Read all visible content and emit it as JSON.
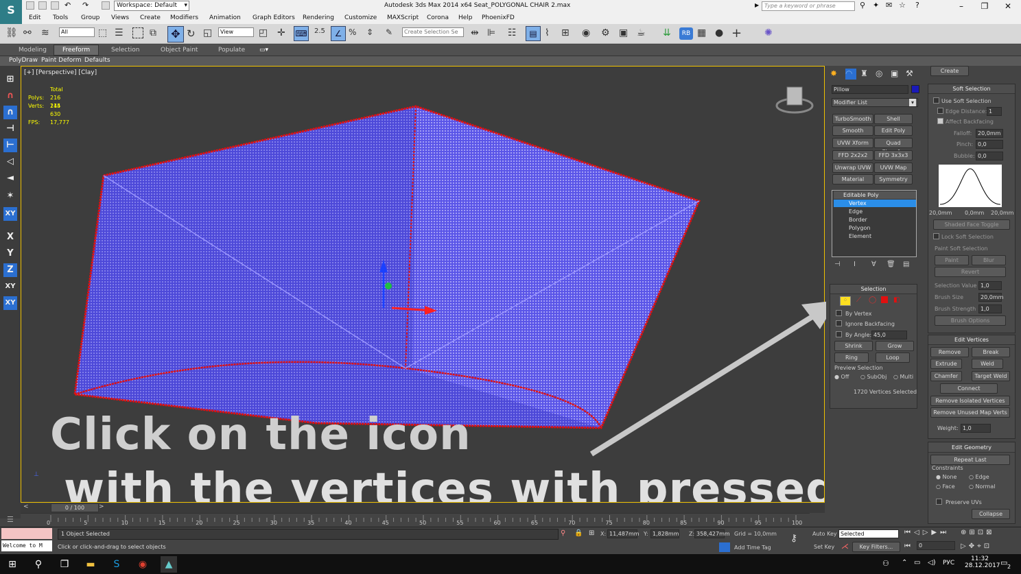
{
  "app": {
    "logo": "S",
    "workspace_label": "Workspace: Default",
    "title": "Autodesk 3ds Max  2014 x64     Seat_POLYGONAL CHAIR 2.max",
    "search_placeholder": "Type a keyword or phrase"
  },
  "menu": [
    "Edit",
    "Tools",
    "Group",
    "Views",
    "Create",
    "Modifiers",
    "Animation",
    "Graph Editors",
    "Rendering",
    "Customize",
    "MAXScript",
    "Corona",
    "Help",
    "PhoenixFD"
  ],
  "toolbar": {
    "selection_filter": "All",
    "ref_coord": "View",
    "snap_value": "2.5",
    "named_selection_placeholder": "Create Selection Se"
  },
  "ribbon": {
    "tabs": [
      "Modeling",
      "Freeform",
      "Selection",
      "Object Paint",
      "Populate"
    ],
    "active_tab": "Freeform",
    "subtabs": [
      "PolyDraw",
      "Paint Deform",
      "Defaults"
    ]
  },
  "viewport": {
    "label": "[+] [Perspective] [Clay]",
    "stats_header": "Total",
    "polys_label": "Polys:",
    "polys_value": "216 214",
    "verts_label": "Verts:",
    "verts_value": "145 630",
    "fps_label": "FPS:",
    "fps_value": "17,777",
    "overlay_line1": "Click on the icon",
    "overlay_line2": "with the vertices with pressed Ctrl"
  },
  "timeline": {
    "frame": "0 / 100",
    "ticks": [
      "0",
      "5",
      "10",
      "15",
      "20",
      "25",
      "30",
      "35",
      "40",
      "45",
      "50",
      "55",
      "60",
      "65",
      "70",
      "75",
      "80",
      "85",
      "90",
      "95",
      "100"
    ]
  },
  "modify_panel": {
    "object_name": "Pillow",
    "modifier_list": "Modifier List",
    "buttons": [
      "TurboSmooth",
      "Shell",
      "Smooth",
      "Edit Poly",
      "UVW Xform",
      "Quad Chamfer",
      "FFD 2x2x2",
      "FFD 3x3x3",
      "Unwrap UVW",
      "UVW Map",
      "Material",
      "Symmetry"
    ],
    "stack": [
      "Editable Poly",
      "Vertex",
      "Edge",
      "Border",
      "Polygon",
      "Element"
    ],
    "selection_header": "Selection",
    "by_vertex": "By Vertex",
    "ignore_backfacing": "Ignore Backfacing",
    "by_angle": "By Angle:",
    "by_angle_value": "45,0",
    "shrink": "Shrink",
    "grow": "Grow",
    "ring": "Ring",
    "loop": "Loop",
    "preview_selection": "Preview Selection",
    "preview_off": "Off",
    "preview_subobj": "SubObj",
    "preview_multi": "Multi",
    "selected_count": "1720 Vertices Selected"
  },
  "soft_selection": {
    "header": "Soft Selection",
    "use_soft": "Use Soft Selection",
    "edge_distance": "Edge Distance:",
    "edge_distance_value": "1",
    "affect_backfacing": "Affect Backfacing",
    "falloff": "Falloff:",
    "falloff_value": "20,0mm",
    "pinch": "Pinch:",
    "pinch_value": "0,0",
    "bubble": "Bubble:",
    "bubble_value": "0,0",
    "curve_left": "20,0mm",
    "curve_mid": "0,0mm",
    "curve_right": "20,0mm",
    "shaded_face_toggle": "Shaded Face Toggle",
    "lock_soft": "Lock Soft Selection",
    "paint_soft": "Paint Soft Selection",
    "paint": "Paint",
    "blur": "Blur",
    "revert": "Revert",
    "selection_value": "Selection Value",
    "selection_value_v": "1,0",
    "brush_size": "Brush Size",
    "brush_size_v": "20,0mm",
    "brush_strength": "Brush Strength",
    "brush_strength_v": "1,0",
    "brush_options": "Brush Options"
  },
  "edit_vertices": {
    "header": "Edit Vertices",
    "remove": "Remove",
    "break": "Break",
    "extrude": "Extrude",
    "weld": "Weld",
    "chamfer": "Chamfer",
    "target_weld": "Target Weld",
    "connect": "Connect",
    "remove_isolated": "Remove Isolated Vertices",
    "remove_unused": "Remove Unused Map Verts",
    "weight": "Weight:",
    "weight_value": "1,0"
  },
  "edit_geometry": {
    "header": "Edit Geometry",
    "repeat_last": "Repeat Last",
    "constraints": "Constraints",
    "none": "None",
    "edge": "Edge",
    "face": "Face",
    "normal": "Normal",
    "preserve_uvs": "Preserve UVs",
    "create": "Create",
    "collapse": "Collapse"
  },
  "status": {
    "welcome": "Welcome to M",
    "objects_selected": "1 Object Selected",
    "prompt": "Click or click-and-drag to select objects",
    "x_label": "X:",
    "x_value": "11,487mm",
    "y_label": "Y:",
    "y_value": "1,828mm",
    "z_label": "Z:",
    "z_value": "358,427mm",
    "grid": "Grid = 10,0mm",
    "add_time_tag": "Add Time Tag",
    "auto_key": "Auto Key",
    "set_key": "Set Key",
    "selected": "Selected",
    "key_filters": "Key Filters...",
    "frame_value": "0"
  },
  "taskbar": {
    "lang": "РУС",
    "time": "11:32",
    "date": "28.12.2017",
    "notif": "2"
  }
}
